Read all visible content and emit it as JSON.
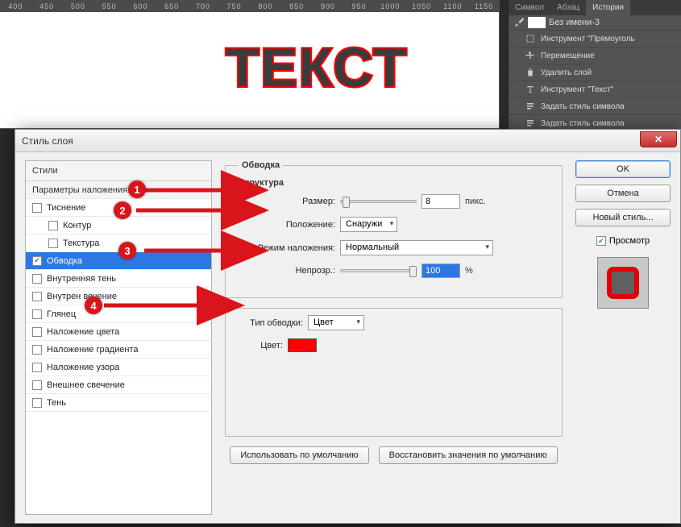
{
  "ruler_marks": [
    "400",
    "450",
    "500",
    "550",
    "600",
    "650",
    "700",
    "750",
    "800",
    "850",
    "900",
    "950",
    "1000",
    "1050",
    "1100",
    "1150"
  ],
  "sample_text": "ТЕКСТ",
  "panel": {
    "tabs": [
      "Символ",
      "Абзац",
      "История"
    ],
    "doc_name": "Без имени-3",
    "items": [
      "Инструмент \"Прямоуголь",
      "Перемещение",
      "Удалить слой",
      "Инструмент \"Текст\"",
      "Задать стиль символа",
      "Задать стиль символа"
    ],
    "item_icons": [
      "rect",
      "move",
      "trash",
      "text",
      "style",
      "style"
    ]
  },
  "dialog": {
    "title": "Стиль слоя",
    "styles_head": "Стили",
    "blend_head": "Параметры наложения: п",
    "style_items": [
      {
        "label": "Тиснение",
        "checked": false,
        "indent": false
      },
      {
        "label": "Контур",
        "checked": false,
        "indent": true
      },
      {
        "label": "Текстура",
        "checked": false,
        "indent": true
      },
      {
        "label": "Обводка",
        "checked": true,
        "indent": false,
        "selected": true
      },
      {
        "label": "Внутренняя тень",
        "checked": false,
        "indent": false
      },
      {
        "label": "Внутрен       вечение",
        "checked": false,
        "indent": false
      },
      {
        "label": "Глянец",
        "checked": false,
        "indent": false
      },
      {
        "label": "Наложение цвета",
        "checked": false,
        "indent": false
      },
      {
        "label": "Наложение градиента",
        "checked": false,
        "indent": false
      },
      {
        "label": "Наложение узора",
        "checked": false,
        "indent": false
      },
      {
        "label": "Внешнее свечение",
        "checked": false,
        "indent": false
      },
      {
        "label": "Тень",
        "checked": false,
        "indent": false
      }
    ],
    "group_title": "Обводка",
    "subgroup_title": "Структура",
    "size_label": "Размер:",
    "size_value": "8",
    "size_unit": "пикс.",
    "position_label": "Положение:",
    "position_value": "Снаружи",
    "blendmode_label": "Режим наложения:",
    "blendmode_value": "Нормальный",
    "opacity_label": "Непрозр.:",
    "opacity_value": "100",
    "opacity_unit": "%",
    "stroketype_label": "Тип обводки:",
    "stroketype_value": "Цвет",
    "color_label": "Цвет:",
    "color_value": "#ff0000",
    "btn_default": "Использовать по умолчанию",
    "btn_restore": "Восстановить значения по умолчанию",
    "btn_ok": "OK",
    "btn_cancel": "Отмена",
    "btn_newstyle": "Новый стиль...",
    "preview_label": "Просмотр"
  },
  "annotations": [
    "1",
    "2",
    "3",
    "4"
  ]
}
